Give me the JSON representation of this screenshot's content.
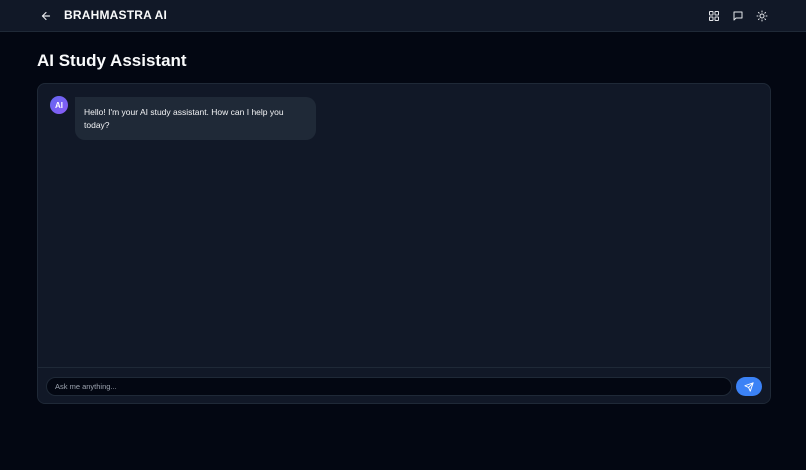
{
  "header": {
    "brand": "BRAHMASTRA AI",
    "back_icon": "arrow-left-icon",
    "icons": [
      "grid-icon",
      "message-icon",
      "sun-icon"
    ]
  },
  "page": {
    "title": "AI Study Assistant"
  },
  "chat": {
    "messages": [
      {
        "sender": "AI",
        "text": "Hello! I'm your AI study assistant. How can I help you today?"
      }
    ]
  },
  "composer": {
    "placeholder": "Ask me anything...",
    "value": "",
    "send_icon": "send-icon"
  },
  "colors": {
    "background": "#030712",
    "panel": "#111827",
    "bubble": "#1f2937",
    "accent": "#3b82f6",
    "avatar": "#6366f1"
  }
}
